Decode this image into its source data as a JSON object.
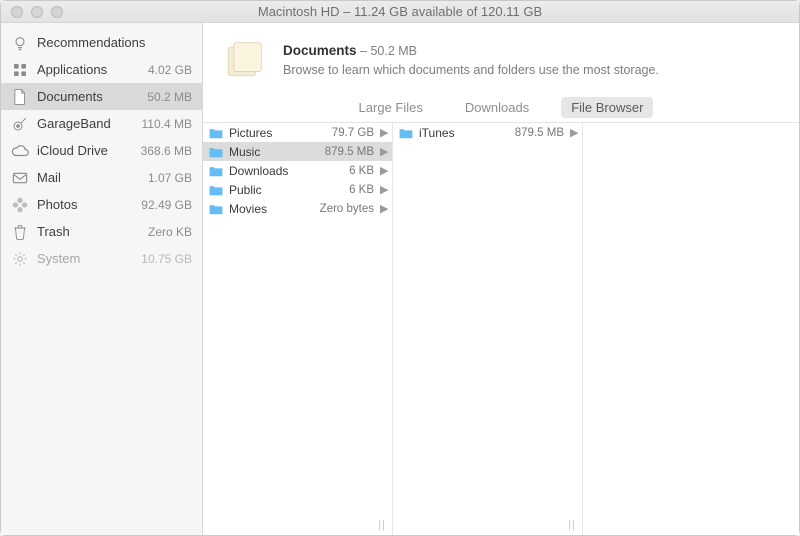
{
  "window": {
    "title": "Macintosh HD – 11.24 GB available of 120.11 GB"
  },
  "sidebar": {
    "items": [
      {
        "icon": "bulb",
        "label": "Recommendations",
        "size": ""
      },
      {
        "icon": "apps",
        "label": "Applications",
        "size": "4.02 GB"
      },
      {
        "icon": "doc",
        "label": "Documents",
        "size": "50.2 MB",
        "selected": true
      },
      {
        "icon": "guitar",
        "label": "GarageBand",
        "size": "110.4 MB"
      },
      {
        "icon": "cloud",
        "label": "iCloud Drive",
        "size": "368.6 MB"
      },
      {
        "icon": "mail",
        "label": "Mail",
        "size": "1.07 GB"
      },
      {
        "icon": "photos",
        "label": "Photos",
        "size": "92.49 GB"
      },
      {
        "icon": "trash",
        "label": "Trash",
        "size": "Zero KB"
      },
      {
        "icon": "gear",
        "label": "System",
        "size": "10.75 GB",
        "dim": true
      }
    ]
  },
  "header": {
    "title": "Documents",
    "size": "50.2 MB",
    "subtitle": "Browse to learn which documents and folders use the most storage."
  },
  "tabs": {
    "items": [
      {
        "label": "Large Files"
      },
      {
        "label": "Downloads"
      },
      {
        "label": "File Browser",
        "selected": true
      }
    ]
  },
  "columns": [
    {
      "rows": [
        {
          "name": "Pictures",
          "size": "79.7 GB"
        },
        {
          "name": "Music",
          "size": "879.5 MB",
          "selected": true
        },
        {
          "name": "Downloads",
          "size": "6 KB"
        },
        {
          "name": "Public",
          "size": "6 KB"
        },
        {
          "name": "Movies",
          "size": "Zero bytes"
        }
      ]
    },
    {
      "rows": [
        {
          "name": "iTunes",
          "size": "879.5 MB"
        }
      ]
    },
    {
      "rows": []
    }
  ]
}
